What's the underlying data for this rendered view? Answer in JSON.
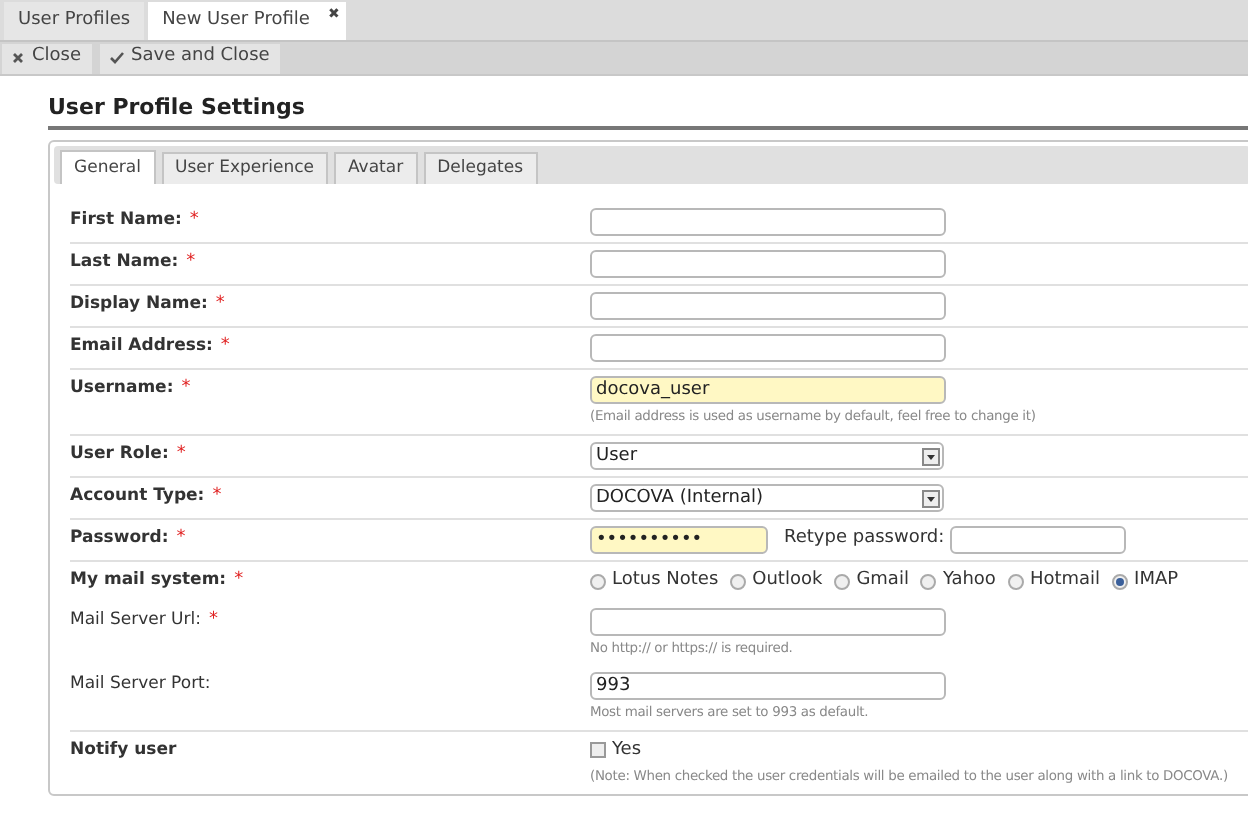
{
  "doc_tabs": [
    {
      "label": "User Profiles",
      "selected": false,
      "closable": false
    },
    {
      "label": "New User Profile",
      "selected": true,
      "closable": true
    }
  ],
  "close_tab_glyph": "✖",
  "toolbar": [
    {
      "kind": "close",
      "label": "Close"
    },
    {
      "kind": "save",
      "label": "Save and Close"
    }
  ],
  "title": "User Profile Settings",
  "tabs": [
    {
      "label": "General",
      "selected": true
    },
    {
      "label": "User Experience",
      "selected": false
    },
    {
      "label": "Avatar",
      "selected": false
    },
    {
      "label": "Delegates",
      "selected": false
    }
  ],
  "required_mark": "*",
  "fields": [
    {
      "kind": "text",
      "label": "First Name:",
      "bold": true,
      "required": true,
      "highlighted": false
    },
    {
      "kind": "text",
      "label": "Last Name:",
      "bold": true,
      "required": true,
      "highlighted": false
    },
    {
      "kind": "text",
      "label": "Display Name:",
      "bold": true,
      "required": true,
      "highlighted": false
    },
    {
      "kind": "text",
      "label": "Email Address:",
      "bold": true,
      "required": true,
      "highlighted": false
    },
    {
      "kind": "text",
      "label": "Username:",
      "bold": true,
      "required": true,
      "value": "docova_user",
      "highlighted": true,
      "hint": "(Email address is used as username by default, feel free to change it)"
    },
    {
      "kind": "select",
      "label": "User Role:",
      "bold": true,
      "required": true,
      "value": "User"
    },
    {
      "kind": "select",
      "label": "Account Type:",
      "bold": true,
      "required": true,
      "value": "DOCOVA (Internal)"
    },
    {
      "kind": "password",
      "label": "Password:",
      "bold": true,
      "required": true,
      "value": "••••••••••",
      "highlighted": true,
      "retype_label": "Retype password:"
    },
    {
      "kind": "radio",
      "label": "My mail system:",
      "bold": true,
      "required": true,
      "options": [
        {
          "label": "Lotus Notes",
          "selected": false
        },
        {
          "label": "Outlook",
          "selected": false
        },
        {
          "label": "Gmail",
          "selected": false
        },
        {
          "label": "Yahoo",
          "selected": false
        },
        {
          "label": "Hotmail",
          "selected": false
        },
        {
          "label": "IMAP",
          "selected": true
        }
      ]
    },
    {
      "kind": "text",
      "label": "Mail Server Url:",
      "bold": false,
      "required": true,
      "highlighted": false,
      "hint": "No http:// or https:// is required."
    },
    {
      "kind": "text",
      "label": "Mail Server Port:",
      "bold": false,
      "required": false,
      "highlighted": false,
      "value": "993",
      "hint": "Most mail servers are set to 993 as default."
    },
    {
      "kind": "checkbox",
      "label": "Notify user",
      "bold": true,
      "required": false,
      "checked": false,
      "option": "Yes",
      "hint": "(Note: When checked the user credentials will be emailed to the user along with a link to DOCOVA.)"
    }
  ]
}
